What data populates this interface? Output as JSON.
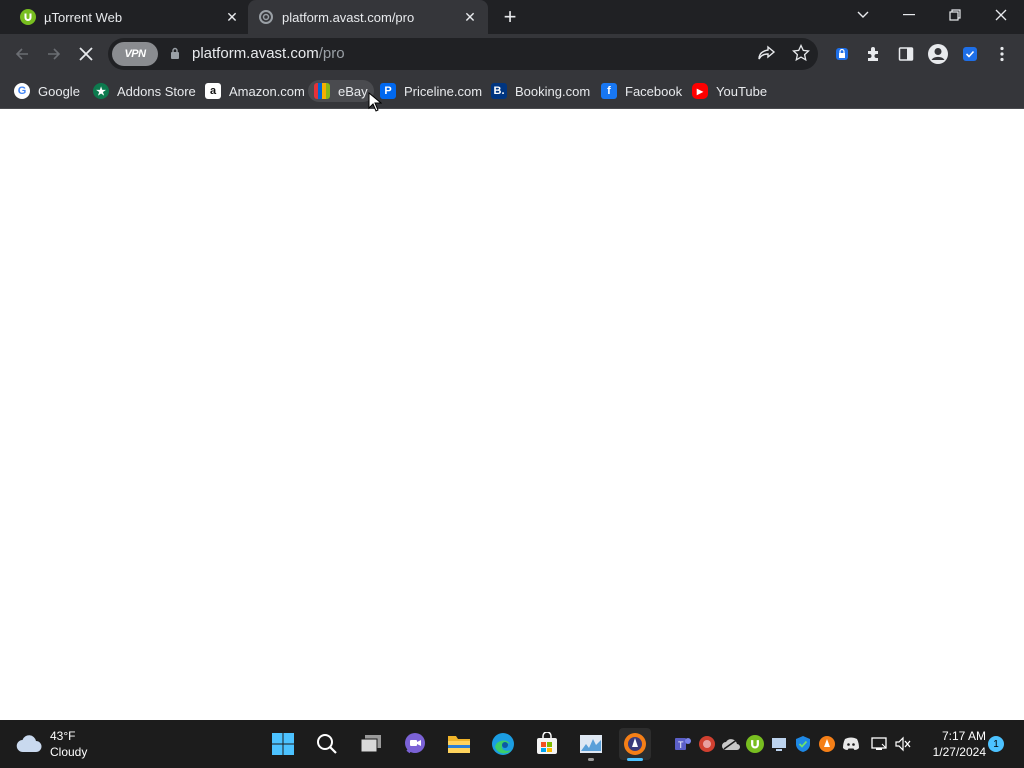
{
  "tabs": [
    {
      "title": "µTorrent Web",
      "icon": "utorrent-icon",
      "active": false
    },
    {
      "title": "platform.avast.com/pro",
      "icon": "loading-spinner-icon",
      "active": true
    }
  ],
  "toolbar": {
    "vpn_label": "VPN",
    "url_host": "platform.avast.com",
    "url_path": "/pro"
  },
  "bookmarks": [
    {
      "label": "Google",
      "icon": "google-icon",
      "color": "#4285f4"
    },
    {
      "label": "Addons Store",
      "icon": "addons-store-icon",
      "color": "#0d7a4e"
    },
    {
      "label": "Amazon.com",
      "icon": "amazon-icon",
      "color": "#ffffff"
    },
    {
      "label": "eBay",
      "icon": "ebay-icon",
      "color": "#e53238"
    },
    {
      "label": "Priceline.com",
      "icon": "priceline-icon",
      "color": "#0068ef"
    },
    {
      "label": "Booking.com",
      "icon": "booking-icon",
      "color": "#003580"
    },
    {
      "label": "Facebook",
      "icon": "facebook-icon",
      "color": "#1877f2"
    },
    {
      "label": "YouTube",
      "icon": "youtube-icon",
      "color": "#ff0000"
    }
  ],
  "taskbar": {
    "weather": {
      "temp": "43°F",
      "condition": "Cloudy"
    },
    "clock": {
      "time": "7:17 AM",
      "date": "1/27/2024"
    },
    "notification_count": "1"
  },
  "colors": {
    "titlebar": "#202124",
    "toolbar": "#35363a",
    "taskbar": "#1c1c1c",
    "accent": "#4cc2ff"
  }
}
